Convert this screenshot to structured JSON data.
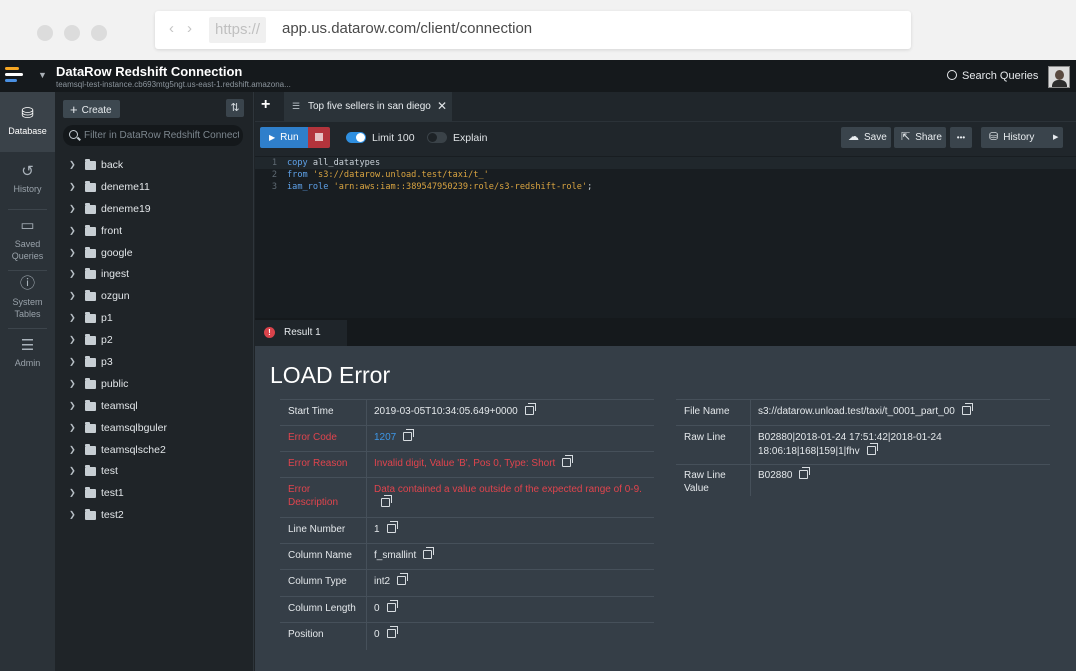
{
  "browser": {
    "protocol": "https://",
    "url": "app.us.datarow.com/client/connection"
  },
  "app": {
    "connection_title": "DataRow Redshift Connection",
    "connection_subtitle": "teamsql-test-instance.cb693mtg5ngt.us-east-1.redshift.amazona...",
    "search_label": "Search Queries",
    "logo_colors": [
      "#f5a623",
      "#ffffff",
      "#4a90e2"
    ]
  },
  "rail": {
    "items": [
      {
        "label": "Database",
        "icon": "database-icon"
      },
      {
        "label": "History",
        "icon": "history-icon"
      },
      {
        "label": "Saved Queries",
        "icon": "folder-icon"
      },
      {
        "label": "System Tables",
        "icon": "info-icon"
      },
      {
        "label": "Admin",
        "icon": "sliders-icon"
      }
    ]
  },
  "tree": {
    "create_label": "Create",
    "filter_placeholder": "Filter in DataRow Redshift Connection",
    "items": [
      "back",
      "deneme11",
      "deneme19",
      "front",
      "google",
      "ingest",
      "ozgun",
      "p1",
      "p2",
      "p3",
      "public",
      "teamsql",
      "teamsqlbguler",
      "teamsqlsche2",
      "test",
      "test1",
      "test2"
    ]
  },
  "editor": {
    "tab_title": "Top five sellers in san diego",
    "run_label": "Run",
    "limit_label": "Limit 100",
    "limit_enabled": true,
    "explain_label": "Explain",
    "explain_enabled": false,
    "save_label": "Save",
    "share_label": "Share",
    "more_label": "•••",
    "history_label": "History",
    "code": [
      {
        "n": "1",
        "kw": "copy",
        "rest": " all_datatypes"
      },
      {
        "n": "2",
        "kw": "from",
        "str": " 's3://datarow.unload.test/taxi/t_'"
      },
      {
        "n": "3",
        "kw": "iam_role",
        "str": " 'arn:aws:iam::389547950239:role/s3-redshift-role'",
        "tail": ";"
      }
    ]
  },
  "result": {
    "tab_label": "Result 1",
    "error_title": "LOAD Error",
    "left": [
      {
        "key": "Start Time",
        "value": "2019-03-05T10:34:05.649+0000"
      },
      {
        "key": "Error Code",
        "value": "1207"
      },
      {
        "key": "Error Reason",
        "value": "Invalid digit, Value 'B', Pos 0, Type: Short"
      },
      {
        "key": "Error Description",
        "value": "Data contained a value outside of the expected range of 0-9."
      },
      {
        "key": "Line Number",
        "value": "1"
      },
      {
        "key": "Column Name",
        "value": "f_smallint"
      },
      {
        "key": "Column Type",
        "value": "int2"
      },
      {
        "key": "Column Length",
        "value": "0"
      },
      {
        "key": "Position",
        "value": "0"
      }
    ],
    "right": [
      {
        "key": "File Name",
        "value": "s3://datarow.unload.test/taxi/t_0001_part_00"
      },
      {
        "key": "Raw Line",
        "value": "B02880|2018-01-24 17:51:42|2018-01-24 18:06:18|168|159|1|fhv"
      },
      {
        "key": "Raw Line Value",
        "value": "B02880"
      }
    ]
  }
}
